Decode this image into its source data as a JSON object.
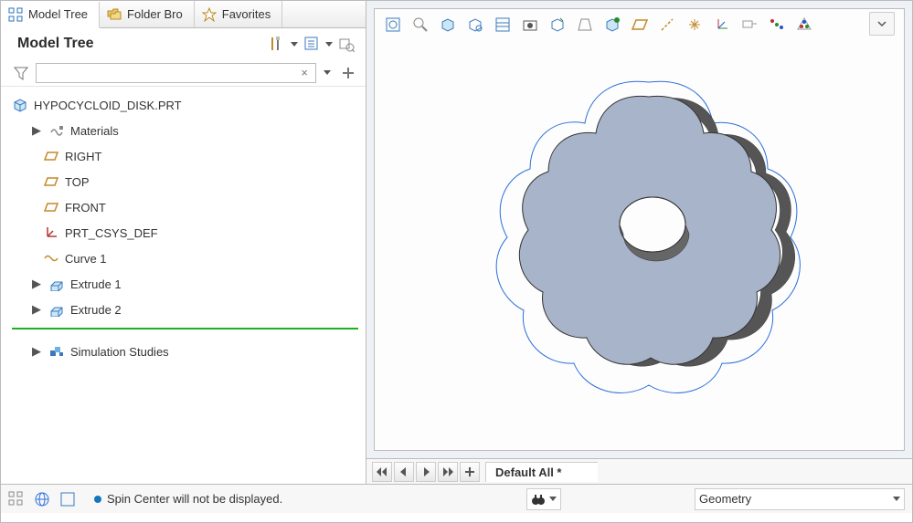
{
  "tabs": {
    "model_tree": "Model Tree",
    "folder_browser": "Folder Bro",
    "favorites": "Favorites"
  },
  "panel_title": "Model Tree",
  "tree": {
    "root": "HYPOCYCLOID_DISK.PRT",
    "materials": "Materials",
    "right": "RIGHT",
    "top": "TOP",
    "front": "FRONT",
    "csys": "PRT_CSYS_DEF",
    "curve1": "Curve 1",
    "extrude1": "Extrude 1",
    "extrude2": "Extrude 2",
    "sim": "Simulation Studies"
  },
  "views_label": "Default All *",
  "status_msg": "Spin Center will not be displayed.",
  "geom_label": "Geometry",
  "search_placeholder": ""
}
